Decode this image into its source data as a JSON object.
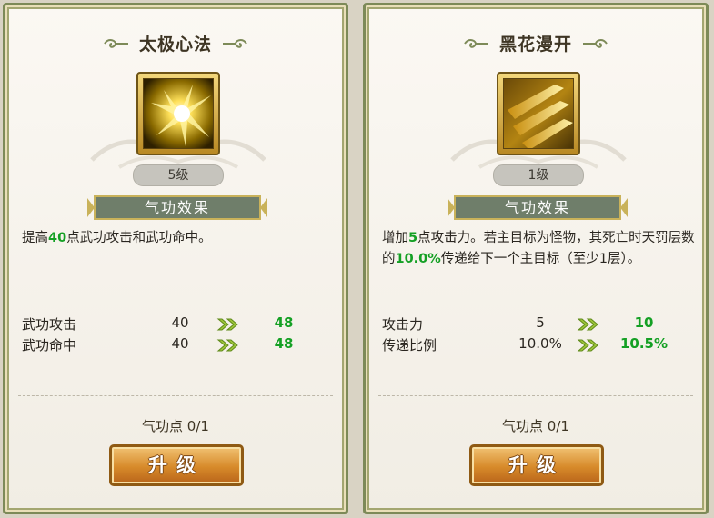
{
  "colors": {
    "highlight": "#14a024",
    "panel_border": "#7d8a58",
    "banner": "#6f7e6a",
    "button": "#d78a2a"
  },
  "panels": [
    {
      "title": "太极心法",
      "icon": "lightning-orb-icon",
      "level": "5级",
      "section_label": "气功效果",
      "desc": [
        {
          "t": "提高",
          "h": false
        },
        {
          "t": "40",
          "h": true
        },
        {
          "t": "点武功攻击和武功命中。",
          "h": false
        }
      ],
      "stats": [
        {
          "label": "武功攻击",
          "current": "40",
          "next": "48"
        },
        {
          "label": "武功命中",
          "current": "40",
          "next": "48"
        }
      ],
      "points": "气功点 0/1",
      "button": "升级"
    },
    {
      "title": "黑花漫开",
      "icon": "golden-blades-icon",
      "level": "1级",
      "section_label": "气功效果",
      "desc": [
        {
          "t": "增加",
          "h": false
        },
        {
          "t": "5",
          "h": true
        },
        {
          "t": "点攻击力。若主目标为怪物，其死亡时天罚层数的",
          "h": false
        },
        {
          "t": "10.0%",
          "h": true
        },
        {
          "t": "传递给下一个主目标（至少1层）。",
          "h": false
        }
      ],
      "stats": [
        {
          "label": "攻击力",
          "current": "5",
          "next": "10"
        },
        {
          "label": "传递比例",
          "current": "10.0%",
          "next": "10.5%"
        }
      ],
      "points": "气功点 0/1",
      "button": "升级"
    }
  ]
}
